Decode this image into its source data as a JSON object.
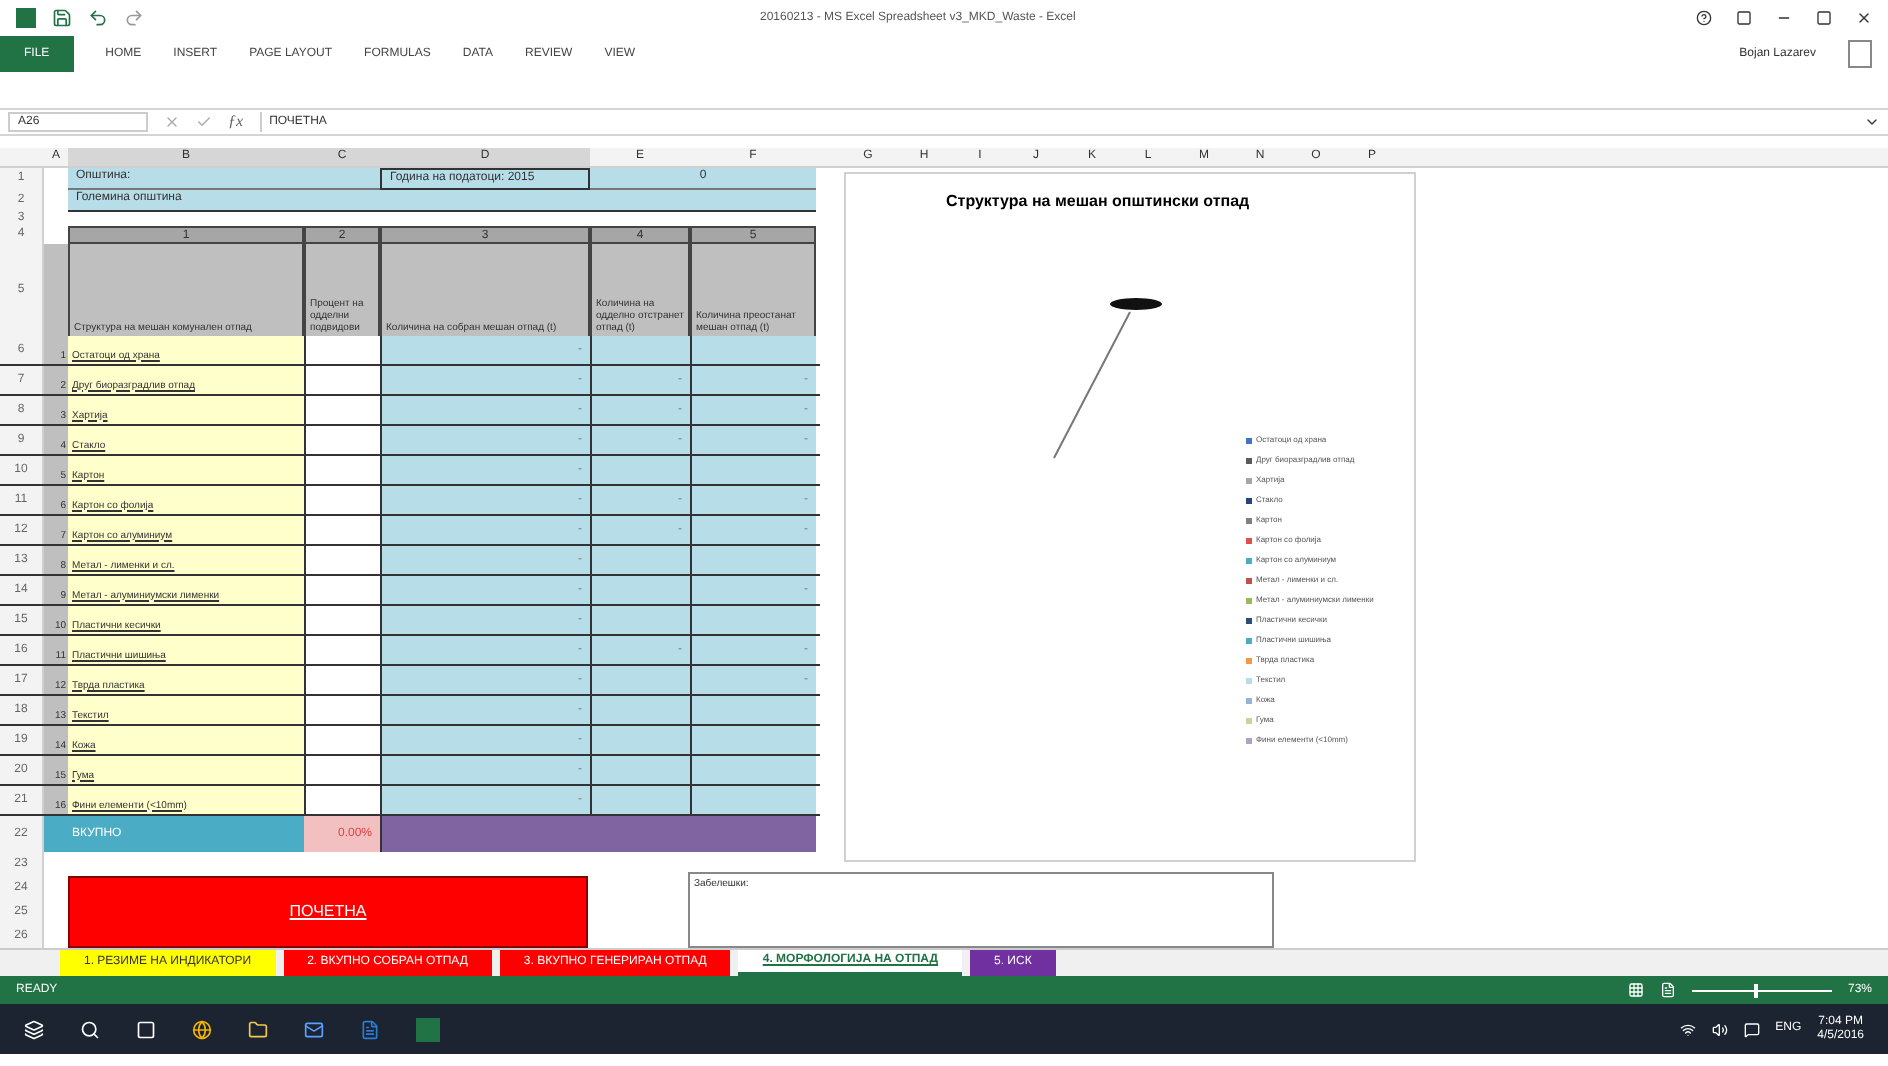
{
  "window": {
    "title": "20160213 - MS Excel Spreadsheet v3_MKD_Waste - Excel",
    "user": "Bojan Lazarev"
  },
  "ribbon_tabs": [
    {
      "label": "FILE",
      "selected": true
    },
    {
      "label": "HOME",
      "selected": false
    },
    {
      "label": "INSERT",
      "selected": false
    },
    {
      "label": "PAGE LAYOUT",
      "selected": false
    },
    {
      "label": "FORMULAS",
      "selected": false
    },
    {
      "label": "DATA",
      "selected": false
    },
    {
      "label": "REVIEW",
      "selected": false
    },
    {
      "label": "VIEW",
      "selected": false
    }
  ],
  "formula_bar": {
    "name_box": "A26",
    "formula": "ПОЧЕТНА",
    "function_label": "ƒx"
  },
  "columns": [
    "A",
    "B",
    "C",
    "D",
    "E",
    "F"
  ],
  "chart_columns": [
    "G",
    "H",
    "I",
    "J",
    "K",
    "L",
    "M",
    "N",
    "O",
    "P"
  ],
  "info": [
    {
      "row": "1",
      "label": "Општина:",
      "year": "Година на податоци: 2015",
      "value": "0"
    },
    {
      "row": "2",
      "label": "Големина општина"
    }
  ],
  "blank_rows": [
    "3"
  ],
  "number_row": {
    "row": "4",
    "cells": [
      "1",
      "2",
      "3",
      "4",
      "5"
    ]
  },
  "header_row": {
    "row": "5",
    "cells": [
      "Структура на мешан комунален отпад",
      "Процент на одделни подвидови",
      "Количина на собран мешан отпад (t)",
      "Количина на одделно отстранет отпад (t)",
      "Количина преостанат мешан отпад (t)"
    ]
  },
  "items": [
    {
      "row": "6",
      "num": "1",
      "label": "Остатоци од храна",
      "cells": [
        "",
        "-",
        "",
        ""
      ]
    },
    {
      "row": "7",
      "num": "2",
      "label": "Друг биоразградлив отпад",
      "cells": [
        "",
        "-",
        "-",
        "-"
      ]
    },
    {
      "row": "8",
      "num": "3",
      "label": "Хартија",
      "cells": [
        "",
        "-",
        "-",
        "-"
      ]
    },
    {
      "row": "9",
      "num": "4",
      "label": "Стакло",
      "cells": [
        "",
        "-",
        "-",
        "-"
      ]
    },
    {
      "row": "10",
      "num": "5",
      "label": "Картон",
      "cells": [
        "",
        "-",
        "",
        ""
      ]
    },
    {
      "row": "11",
      "num": "6",
      "label": "Картон со фолија",
      "cells": [
        "",
        "-",
        "-",
        "-"
      ]
    },
    {
      "row": "12",
      "num": "7",
      "label": "Картон со алуминиум",
      "cells": [
        "",
        "-",
        "-",
        "-"
      ]
    },
    {
      "row": "13",
      "num": "8",
      "label": "Метал - лименки и сл.",
      "cells": [
        "",
        "-",
        "",
        ""
      ]
    },
    {
      "row": "14",
      "num": "9",
      "label": "Метал - алуминиумски лименки",
      "cells": [
        "",
        "-",
        "",
        "-"
      ]
    },
    {
      "row": "15",
      "num": "10",
      "label": "Пластични кесички",
      "cells": [
        "",
        "-",
        "",
        ""
      ]
    },
    {
      "row": "16",
      "num": "11",
      "label": "Пластични шишиња",
      "cells": [
        "",
        "-",
        "-",
        "-"
      ]
    },
    {
      "row": "17",
      "num": "12",
      "label": "Тврда пластика",
      "cells": [
        "",
        "-",
        "",
        "-"
      ]
    },
    {
      "row": "18",
      "num": "13",
      "label": "Текстил",
      "cells": [
        "",
        "-",
        "",
        ""
      ]
    },
    {
      "row": "19",
      "num": "14",
      "label": "Кожа",
      "cells": [
        "",
        "-",
        "",
        ""
      ]
    },
    {
      "row": "20",
      "num": "15",
      "label": "Гума",
      "cells": [
        "",
        "-",
        "",
        ""
      ]
    },
    {
      "row": "21",
      "num": "16",
      "label": "Фини елементи (<10mm)",
      "cells": [
        "",
        "-",
        "",
        ""
      ]
    }
  ],
  "total": {
    "row": "22",
    "label": "ВКУПНО",
    "percent": "0.00%"
  },
  "bottom_rows": [
    "23",
    "24",
    "25",
    "26"
  ],
  "home_button": "ПОЧЕТНА",
  "comment_box": "Забелешки:",
  "chart": {
    "title": "Структура на мешан општински отпад",
    "legend": [
      {
        "label": "Остатоци од храна",
        "color": "#4472c4"
      },
      {
        "label": "Друг биоразградлив отпад",
        "color": "#5b5b5b"
      },
      {
        "label": "Хартија",
        "color": "#a5a5a5"
      },
      {
        "label": "Стакло",
        "color": "#264478"
      },
      {
        "label": "Картон",
        "color": "#7f7f7f"
      },
      {
        "label": "Картон со фолија",
        "color": "#e0504a"
      },
      {
        "label": "Картон со алуминиум",
        "color": "#4bacc6"
      },
      {
        "label": "Метал - лименки и сл.",
        "color": "#c0504d"
      },
      {
        "label": "Метал - алуминиумски лименки",
        "color": "#9bbb59"
      },
      {
        "label": "Пластични кесички",
        "color": "#2c4d75"
      },
      {
        "label": "Пластични шишиња",
        "color": "#4bacc6"
      },
      {
        "label": "Тврда пластика",
        "color": "#f79646"
      },
      {
        "label": "Текстил",
        "color": "#b7dde8"
      },
      {
        "label": "Кожа",
        "color": "#95b3d7"
      },
      {
        "label": "Гума",
        "color": "#c3d69b"
      },
      {
        "label": "Фини елементи (<10mm)",
        "color": "#b2a1c7"
      }
    ]
  },
  "sheet_tabs": [
    {
      "label": "1. РЕЗИМЕ НА ИНДИКАТОРИ",
      "color": "#ffff00",
      "selected": false
    },
    {
      "label": "2. ВКУПНО СОБРАН ОТПАД",
      "color": "#ff0000",
      "selected": false
    },
    {
      "label": "3. ВКУПНО ГЕНЕРИРАН ОТПАД",
      "color": "#ff0000",
      "selected": false
    },
    {
      "label": "4. МОРФОЛОГИЈА НА ОТПАД",
      "color": "#ffffff",
      "selected": true
    },
    {
      "label": "5. ИСК",
      "color": "#7030a0",
      "selected": false
    }
  ],
  "status": {
    "mode": "READY",
    "zoom": "73%",
    "zoom_slider": {
      "level": 0.45
    }
  },
  "taskbar": {
    "language": "ENG",
    "time": "7:04 PM",
    "date": "4/5/2016"
  }
}
